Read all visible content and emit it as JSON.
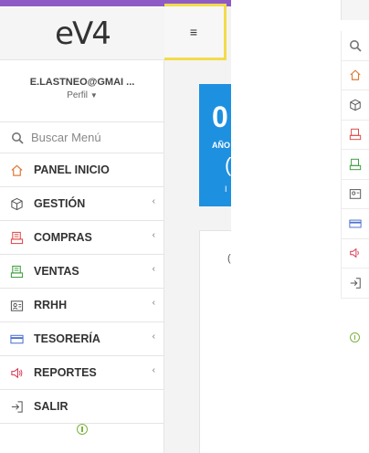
{
  "app": {
    "logo_text": "eV4"
  },
  "user": {
    "email": "E.LASTNEO@GMAI ...",
    "profile_label": "Perfil"
  },
  "search": {
    "placeholder": "Buscar  Menú"
  },
  "menu": {
    "items": [
      {
        "label": "PANEL INICIO",
        "icon": "home-icon",
        "color": "#e07b39",
        "has_submenu": false
      },
      {
        "label": "GESTIÓN",
        "icon": "cube-icon",
        "color": "#555555",
        "has_submenu": true
      },
      {
        "label": "COMPRAS",
        "icon": "register-icon",
        "color": "#e04545",
        "has_submenu": true
      },
      {
        "label": "VENTAS",
        "icon": "register-icon",
        "color": "#3a9b3a",
        "has_submenu": true
      },
      {
        "label": "RRHH",
        "icon": "id-card-icon",
        "color": "#555555",
        "has_submenu": true
      },
      {
        "label": "TESORERÍA",
        "icon": "credit-card-icon",
        "color": "#4a6fd0",
        "has_submenu": true
      },
      {
        "label": "REPORTES",
        "icon": "megaphone-icon",
        "color": "#d9334f",
        "has_submenu": true
      },
      {
        "label": "SALIR",
        "icon": "sign-in-icon",
        "color": "#555555",
        "has_submenu": false
      }
    ]
  },
  "header": {
    "menu_toggle": "≡"
  },
  "dashboard": {
    "card_value": "0",
    "card_label": "AÑO",
    "card_value_2": "(",
    "card_sublabel": "I",
    "panel_text": "("
  },
  "colors": {
    "accent": "#8e5bc6",
    "highlight": "#f2dc4a",
    "card_blue": "#1e90e0",
    "online": "#7cb342"
  }
}
